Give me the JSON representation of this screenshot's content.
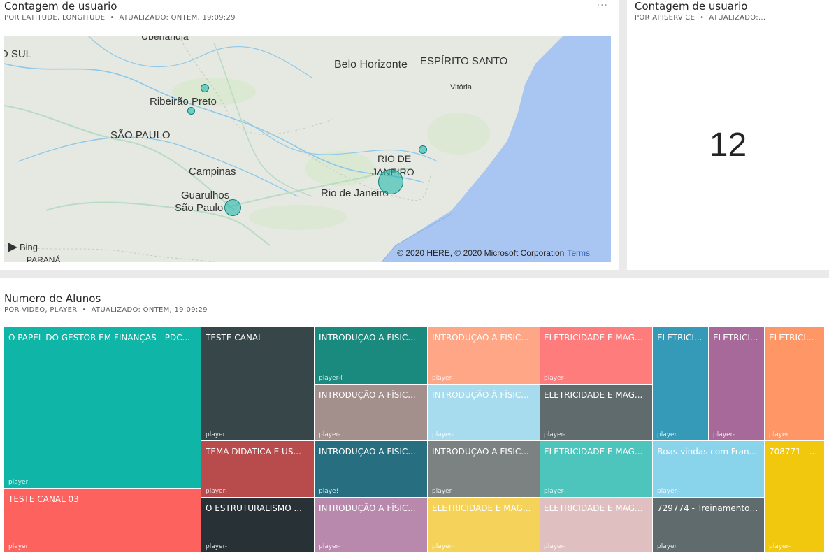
{
  "map_tile": {
    "title": "Contagem de usuario",
    "subtitle": "POR LATITUDE, LONGITUDE",
    "updated": "ATUALIZADO: ONTEM, 19:09:29",
    "more": "···",
    "labels": {
      "uberlandia": "Uberlândia",
      "sul": "O SUL",
      "belo_horizonte": "Belo Horizonte",
      "espirito_santo": "ESPÍRITO SANTO",
      "vitoria": "Vitória",
      "ribeirao_preto": "Ribeirão Preto",
      "sao_paulo_state": "SÃO PAULO",
      "rio_de": "RIO DE",
      "janeiro": "JANEIRO",
      "campinas": "Campinas",
      "rio_de_janeiro_city": "Rio de Janeiro",
      "guarulhos": "Guarulhos",
      "sao_paulo_city": "São Paulo",
      "parana": "PARANÁ"
    },
    "bing": "Bing",
    "copyright": "© 2020 HERE, © 2020 Microsoft Corporation",
    "terms": "Terms"
  },
  "card_tile": {
    "title": "Contagem de usuario",
    "subtitle": "POR APISERVICE",
    "updated": "ATUALIZADO:...",
    "value": "12"
  },
  "treemap_tile": {
    "title": "Numero de Alunos",
    "subtitle": "POR VIDEO, PLAYER",
    "updated": "ATUALIZADO: ONTEM, 19:09:29",
    "cells": [
      {
        "name": "O PAPEL DO GESTOR EM FINANÇAS - PDC...",
        "player": "player",
        "color": "#0fb5a6"
      },
      {
        "name": "TESTE CANAL 03",
        "player": "player",
        "color": "#fd625e"
      },
      {
        "name": "TESTE CANAL",
        "player": "player",
        "color": "#374649"
      },
      {
        "name": "TEMA DIDÁTICA E US...",
        "player": "player-",
        "color": "#b84b4b"
      },
      {
        "name": "O ESTRUTURALISMO ...",
        "player": "player-",
        "color": "#283236"
      },
      {
        "name": "INTRODUÇÃO A FÍSIC...",
        "player": "player-(",
        "color": "#1b8a7e"
      },
      {
        "name": "INTRODUÇÃO A FÍSIC...",
        "player": "player-",
        "color": "#a38f8c"
      },
      {
        "name": "INTRODUÇÃO A FÍSIC...",
        "player": "playe!",
        "color": "#266e80"
      },
      {
        "name": "INTRODUÇÃO A FÍSIC...",
        "player": "player-",
        "color": "#b888ad"
      },
      {
        "name": "INTRODUÇÃO À FÍSIC...",
        "player": "player-",
        "color": "#fea685"
      },
      {
        "name": "INTRODUÇÃO À FÍSIC...",
        "player": "player-",
        "color": "#a6dcee"
      },
      {
        "name": "INTRODUÇÃO À FÍSIC...",
        "player": "player",
        "color": "#7c8282"
      },
      {
        "name": "ELETRICIDADE E MAG...",
        "player": "player-",
        "color": "#f5d25a"
      },
      {
        "name": "ELETRICIDADE E MAG...",
        "player": "player-",
        "color": "#fe7c7c"
      },
      {
        "name": "ELETRICIDADE E MAG...",
        "player": "player-",
        "color": "#5f6b6d"
      },
      {
        "name": "ELETRICIDADE E MAG...",
        "player": "player-",
        "color": "#4dc4bc"
      },
      {
        "name": "ELETRICIDADE E MAG...",
        "player": "player-",
        "color": "#dfbfbf"
      },
      {
        "name": "ELETRICI...",
        "player": "player",
        "color": "#3599b8"
      },
      {
        "name": "ELETRICI...",
        "player": "player-",
        "color": "#a66999"
      },
      {
        "name": "ELETRICI...",
        "player": "player",
        "color": "#fe9666"
      },
      {
        "name": "Boas-vindas com Fran...",
        "player": "player-",
        "color": "#8ad4eb"
      },
      {
        "name": "729774 - Treinamento ...",
        "player": "player",
        "color": "#5f6b6d"
      },
      {
        "name": "708771 - ...",
        "player": "player-",
        "color": "#f2c80f"
      }
    ]
  }
}
